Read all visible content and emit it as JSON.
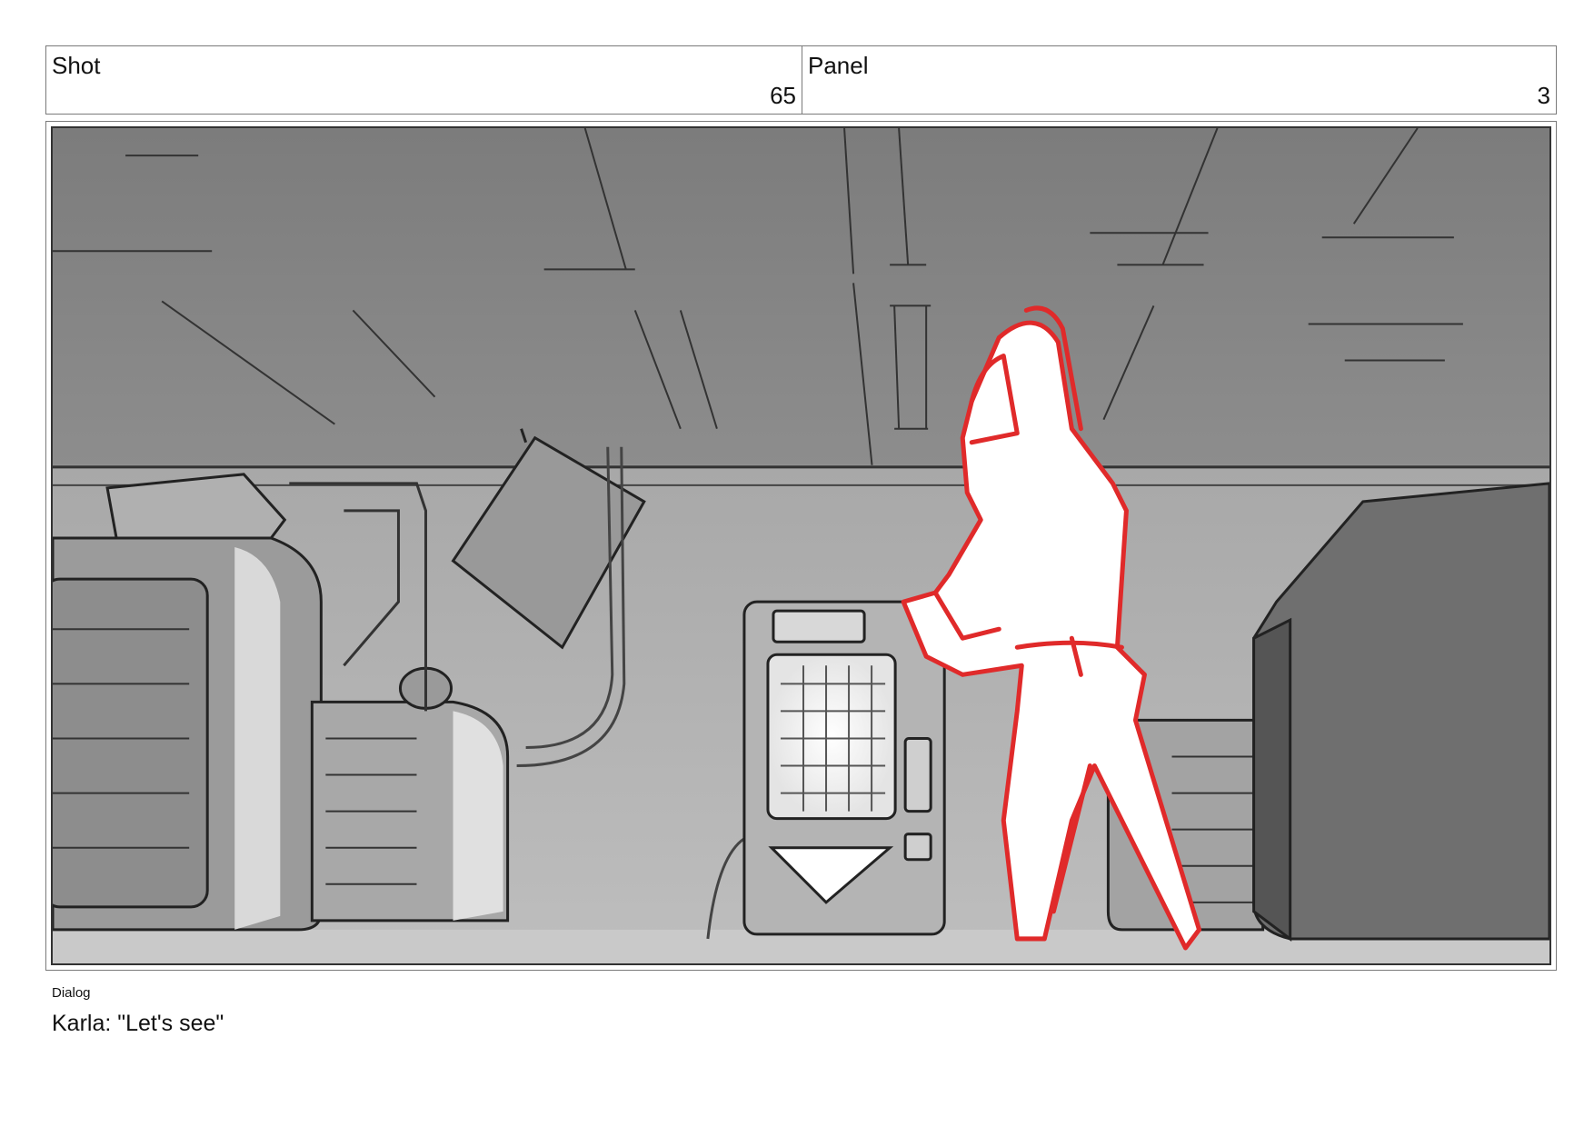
{
  "header": {
    "shot_label": "Shot",
    "shot_number": "65",
    "panel_label": "Panel",
    "panel_number": "3"
  },
  "storyboard_frame": {
    "character_color": "#e02a2a"
  },
  "dialog": {
    "label": "Dialog",
    "text": "Karla: \"Let's see\""
  }
}
